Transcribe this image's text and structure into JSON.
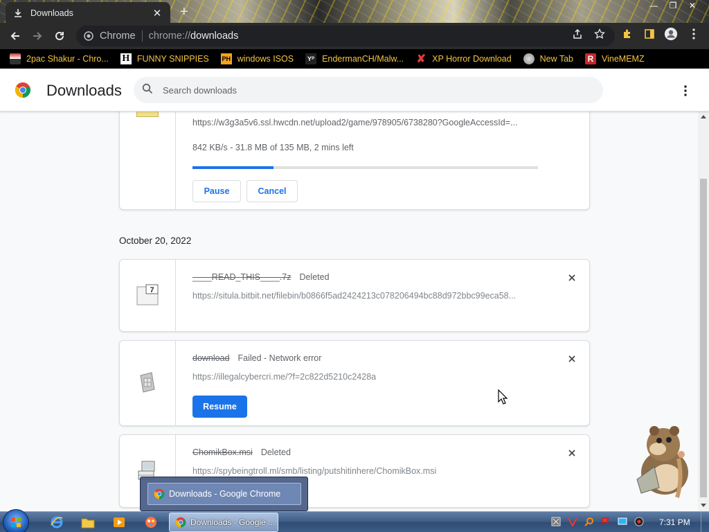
{
  "browser": {
    "tab_title": "Downloads",
    "omnibox_label": "Chrome",
    "url_prefix": "chrome://",
    "url_path": "downloads"
  },
  "bookmarks": [
    {
      "label": "2pac Shakur - Chro...",
      "icon": "tupac-icon"
    },
    {
      "label": "FUNNY SNIPPIES",
      "icon": "h-icon"
    },
    {
      "label": "windows ISOS",
      "icon": "ph-icon"
    },
    {
      "label": "EndermanCH/Malw...",
      "icon": "yp-icon"
    },
    {
      "label": "XP Horror Download",
      "icon": "x-icon"
    },
    {
      "label": "New Tab",
      "icon": "globe-icon"
    },
    {
      "label": "VineMEMZ",
      "icon": "r-icon"
    }
  ],
  "downloads_page": {
    "title": "Downloads",
    "search_placeholder": "Search downloads",
    "date_header": "October 20, 2022"
  },
  "active_download": {
    "url": "https://w3g3a5v6.ssl.hwcdn.net/upload2/game/978905/6738280?GoogleAccessId=...",
    "progress_text": "842 KB/s - 31.8 MB of 135 MB, 2 mins left",
    "progress_fraction": 0.235,
    "pause_label": "Pause",
    "cancel_label": "Cancel"
  },
  "items": [
    {
      "filename": "____READ_THIS____.7z",
      "status": "Deleted",
      "url": "https://situla.bitbit.net/filebin/b0866f5ad2424213c078206494bc88d972bbc99eca58..."
    },
    {
      "filename": "download",
      "status": "Failed - Network error",
      "url": "https://illegalcybercri.me/?f=2c822d5210c2428a",
      "action_label": "Resume"
    },
    {
      "filename": "ChomikBox.msi",
      "status": "Deleted",
      "url": "https://spybeingtroll.ml/smb/listing/putshitinhere/ChomikBox.msi"
    }
  ],
  "taskbar": {
    "preview_label": "Downloads - Google Chrome",
    "chrome_button_label": "Downloads - Google ...",
    "clock": "7:31 PM"
  },
  "colors": {
    "accent": "#1a73e8",
    "bookmark_text": "#f4c542"
  }
}
